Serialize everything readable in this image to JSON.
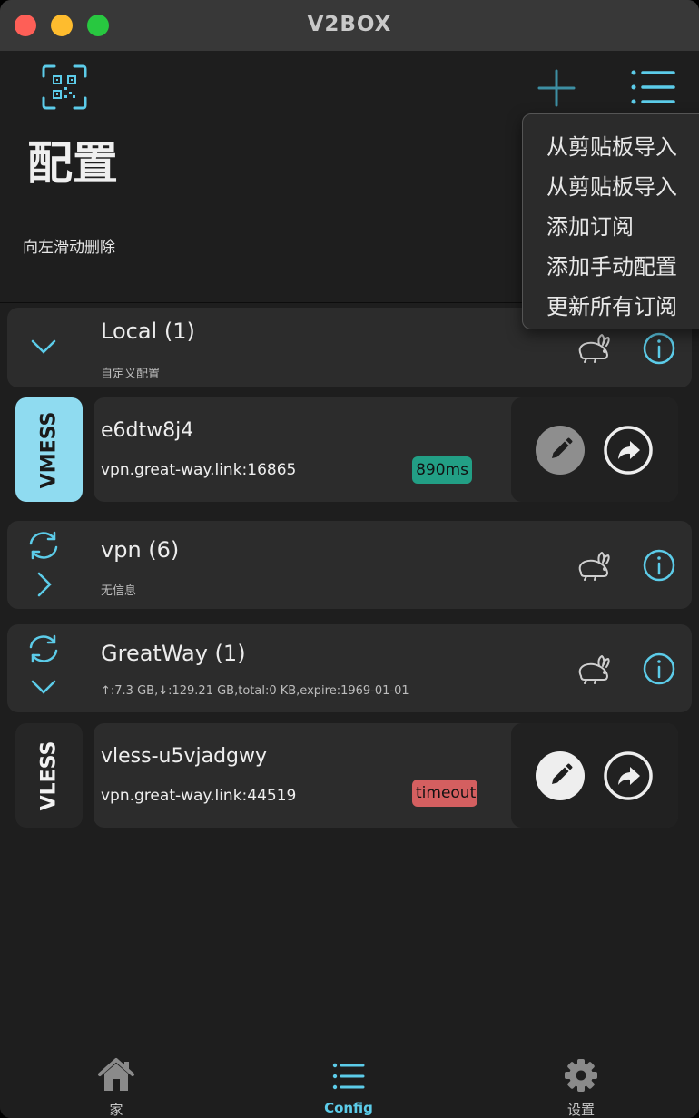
{
  "window": {
    "title": "V2BOX"
  },
  "header": {
    "title": "配置",
    "hint": "向左滑动删除"
  },
  "popup_menu": {
    "items": [
      "从剪贴板导入",
      "从剪贴板导入",
      "添加订阅",
      "添加手动配置",
      "更新所有订阅"
    ]
  },
  "groups": [
    {
      "name": "Local (1)",
      "subtitle": "自定义配置"
    },
    {
      "name": "vpn (6)",
      "subtitle": "无信息"
    },
    {
      "name": "GreatWay (1)",
      "subtitle": "↑:7.3 GB,↓:129.21 GB,total:0 KB,expire:1969-01-01"
    }
  ],
  "configs": [
    {
      "protocol": "VMESS",
      "name": "e6dtw8j4",
      "address": "vpn.great-way.link:16865",
      "latency": "890ms",
      "latency_color": "#229f85"
    },
    {
      "protocol": "VLESS",
      "name": "vless-u5vjadgwy",
      "address": "vpn.great-way.link:44519",
      "latency": "timeout",
      "latency_color": "#d45f60"
    }
  ],
  "bottom_nav": {
    "items": [
      {
        "label": "家",
        "icon": "home-icon",
        "active": false
      },
      {
        "label": "Config",
        "icon": "list-icon",
        "active": true
      },
      {
        "label": "设置",
        "icon": "gear-icon",
        "active": false
      }
    ]
  },
  "colors": {
    "accent": "#5ccce9",
    "background": "#1e1e1e",
    "card": "#2c2c2c",
    "vmess_tag": "#8fdbf0"
  }
}
